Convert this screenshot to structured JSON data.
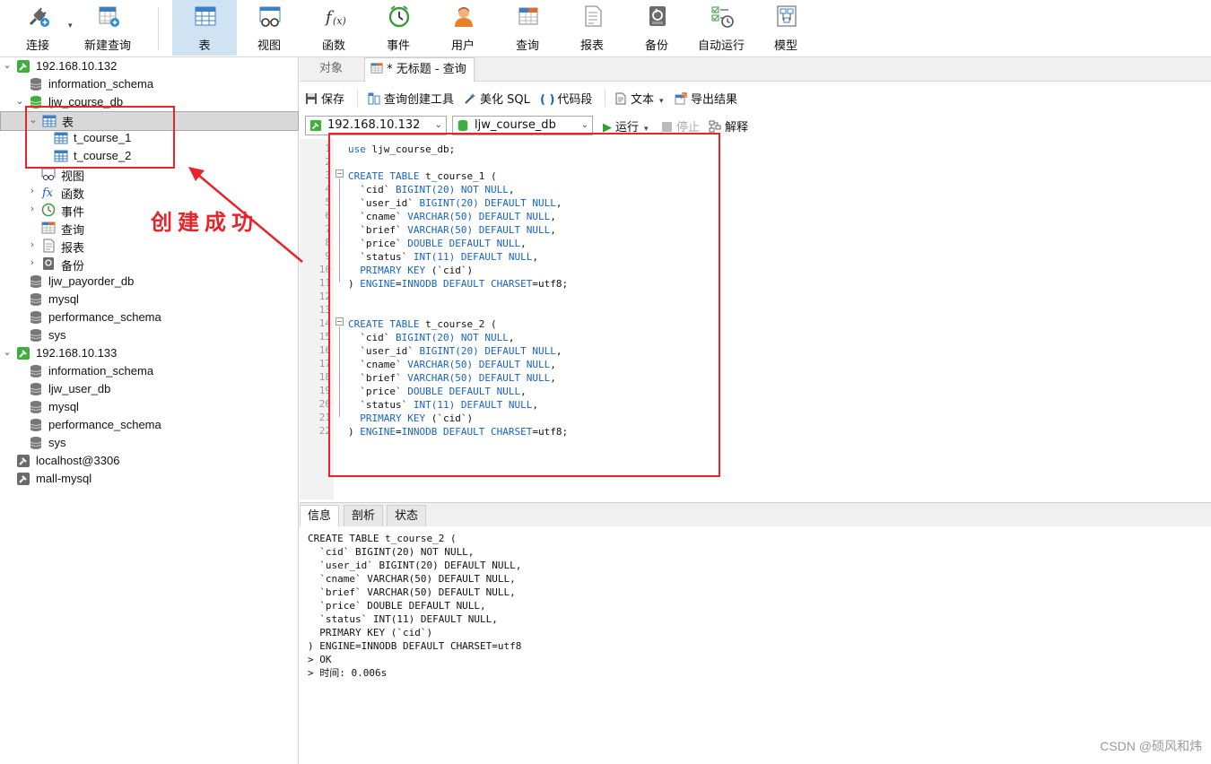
{
  "toolbar": {
    "items": [
      {
        "label": "连接",
        "icon": "connect-plug-icon"
      },
      {
        "label": "新建查询",
        "icon": "new-query-icon"
      },
      {
        "label": "表",
        "icon": "table-icon"
      },
      {
        "label": "视图",
        "icon": "view-icon"
      },
      {
        "label": "函数",
        "icon": "function-icon"
      },
      {
        "label": "事件",
        "icon": "clock-event-icon"
      },
      {
        "label": "用户",
        "icon": "user-icon"
      },
      {
        "label": "查询",
        "icon": "query-icon"
      },
      {
        "label": "报表",
        "icon": "report-icon"
      },
      {
        "label": "备份",
        "icon": "backup-icon"
      },
      {
        "label": "自动运行",
        "icon": "auto-run-icon"
      },
      {
        "label": "模型",
        "icon": "model-icon"
      }
    ],
    "active": "表"
  },
  "sidebar": {
    "nodes": [
      {
        "label": "192.168.10.132",
        "type": "connection"
      },
      {
        "label": "information_schema",
        "type": "database"
      },
      {
        "label": "ljw_course_db",
        "type": "database-open"
      },
      {
        "label": "表",
        "type": "tables-folder"
      },
      {
        "label": "t_course_1",
        "type": "table"
      },
      {
        "label": "t_course_2",
        "type": "table"
      },
      {
        "label": "视图",
        "type": "views-folder"
      },
      {
        "label": "函数",
        "type": "functions-folder"
      },
      {
        "label": "事件",
        "type": "events-folder"
      },
      {
        "label": "查询",
        "type": "queries-folder"
      },
      {
        "label": "报表",
        "type": "reports-folder"
      },
      {
        "label": "备份",
        "type": "backups-folder"
      },
      {
        "label": "ljw_payorder_db",
        "type": "database"
      },
      {
        "label": "mysql",
        "type": "database"
      },
      {
        "label": "performance_schema",
        "type": "database"
      },
      {
        "label": "sys",
        "type": "database"
      },
      {
        "label": "192.168.10.133",
        "type": "connection"
      },
      {
        "label": "information_schema",
        "type": "database"
      },
      {
        "label": "ljw_user_db",
        "type": "database"
      },
      {
        "label": "mysql",
        "type": "database"
      },
      {
        "label": "performance_schema",
        "type": "database"
      },
      {
        "label": "sys",
        "type": "database"
      },
      {
        "label": "localhost@3306",
        "type": "connection-closed"
      },
      {
        "label": "mall-mysql",
        "type": "connection-closed"
      }
    ]
  },
  "tabs": {
    "objects": "对象",
    "query": "* 无标题 - 查询"
  },
  "query_toolbar": {
    "save": "保存",
    "builder": "查询创建工具",
    "beautify": "美化 SQL",
    "snippet": "代码段",
    "text": "文本",
    "export": "导出结果"
  },
  "selectors": {
    "connection": "192.168.10.132",
    "database": "ljw_course_db",
    "run": "运行",
    "stop": "停止",
    "explain": "解释"
  },
  "editor": {
    "lines": [
      "use ljw_course_db;",
      "",
      "CREATE TABLE t_course_1 (",
      "  `cid` BIGINT(20) NOT NULL,",
      "  `user_id` BIGINT(20) DEFAULT NULL,",
      "  `cname` VARCHAR(50) DEFAULT NULL,",
      "  `brief` VARCHAR(50) DEFAULT NULL,",
      "  `price` DOUBLE DEFAULT NULL,",
      "  `status` INT(11) DEFAULT NULL,",
      "  PRIMARY KEY (`cid`)",
      ") ENGINE=INNODB DEFAULT CHARSET=utf8;",
      "",
      "",
      "CREATE TABLE t_course_2 (",
      "  `cid` BIGINT(20) NOT NULL,",
      "  `user_id` BIGINT(20) DEFAULT NULL,",
      "  `cname` VARCHAR(50) DEFAULT NULL,",
      "  `brief` VARCHAR(50) DEFAULT NULL,",
      "  `price` DOUBLE DEFAULT NULL,",
      "  `status` INT(11) DEFAULT NULL,",
      "  PRIMARY KEY (`cid`)",
      ") ENGINE=INNODB DEFAULT CHARSET=utf8;"
    ]
  },
  "bottom_tabs": [
    "信息",
    "剖析",
    "状态"
  ],
  "output": {
    "lines": [
      "CREATE TABLE t_course_2 (",
      "  `cid` BIGINT(20) NOT NULL,",
      "  `user_id` BIGINT(20) DEFAULT NULL,",
      "  `cname` VARCHAR(50) DEFAULT NULL,",
      "  `brief` VARCHAR(50) DEFAULT NULL,",
      "  `price` DOUBLE DEFAULT NULL,",
      "  `status` INT(11) DEFAULT NULL,",
      "  PRIMARY KEY (`cid`)",
      ") ENGINE=INNODB DEFAULT CHARSET=utf8",
      "> OK",
      "> 时间: 0.006s"
    ]
  },
  "annotation": {
    "text": "创建成功",
    "color": "#e8232a"
  },
  "watermark": "CSDN @硕风和炜"
}
